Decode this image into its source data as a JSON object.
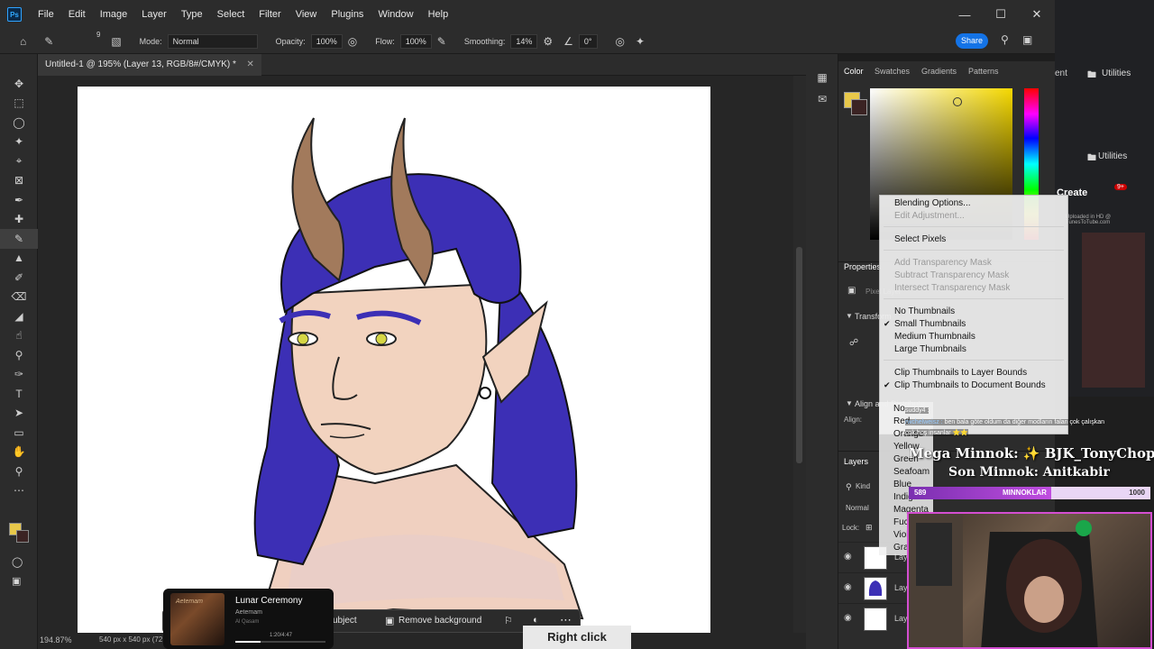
{
  "menubar": {
    "items": [
      "File",
      "Edit",
      "Image",
      "Layer",
      "Type",
      "Select",
      "Filter",
      "View",
      "Plugins",
      "Window",
      "Help"
    ]
  },
  "options": {
    "mode_label": "Mode:",
    "mode_value": "Normal",
    "opacity_label": "Opacity:",
    "opacity_value": "100%",
    "flow_label": "Flow:",
    "flow_value": "100%",
    "smoothing_label": "Smoothing:",
    "smoothing_value": "14%",
    "angle_value": "0°",
    "brush_size": "9",
    "share_label": "Share"
  },
  "document": {
    "tab_title": "Untitled-1 @ 195% (Layer 13, RGB/8#/CMYK) *",
    "zoom": "194.87%",
    "size_info": "540 px x 540 px (72"
  },
  "contextual_bar": {
    "select_subject": "ubject",
    "remove_background": "Remove background"
  },
  "media": {
    "title": "Lunar Ceremony",
    "artist": "Aetemam",
    "album": "Al Qasam",
    "time": "1:20/4:47",
    "art_text": "Aetemam"
  },
  "overlay": {
    "right_click": "Right click"
  },
  "color_panel": {
    "tabs": [
      "Color",
      "Swatches",
      "Gradients",
      "Patterns"
    ],
    "foreground": "#e8c84a",
    "background": "#3b2323"
  },
  "properties": {
    "title": "Properties",
    "pixel_layer": "Pixel Layer",
    "transform": "Transform",
    "align": "Align and Distribute",
    "align_label": "Align:"
  },
  "layers_panel": {
    "title": "Layers",
    "kind": "Kind",
    "blend": "Normal",
    "lock": "Lock:",
    "layer_name": "Lay"
  },
  "context_menu": {
    "blending_options": "Blending Options...",
    "edit_adjustment": "Edit Adjustment...",
    "select_pixels": "Select Pixels",
    "add_mask": "Add Transparency Mask",
    "subtract_mask": "Subtract Transparency Mask",
    "intersect_mask": "Intersect Transparency Mask",
    "no_thumbnails": "No Thumbnails",
    "small_thumbnails": "Small Thumbnails",
    "medium_thumbnails": "Medium Thumbnails",
    "large_thumbnails": "Large Thumbnails",
    "clip_layer": "Clip Thumbnails to Layer Bounds",
    "clip_document": "Clip Thumbnails to Document Bounds",
    "checkmark": "✔"
  },
  "color_labels": [
    "No",
    "Red",
    "Orange",
    "Yellow",
    "Green",
    "Seafoam",
    "Blue",
    "Indigo",
    "Magenta",
    "Fuchsia",
    "Violet",
    "Gray"
  ],
  "browser": {
    "utilities": "Utilities",
    "create": "Create",
    "badge": "9+",
    "event": "ent",
    "uploaded": "Uploaded in HD @ TunesToTube.com"
  },
  "stream": {
    "chat_user1": "suddy4 :",
    "chat_user2": "rwchelweisz :",
    "chat_msg": "ben bala göte oldum da diğer modların falan çok çalışkan",
    "chat_msg2": "çok hoş insanlar ⭐⭐",
    "mega_minnok": "Mega Minnok: ✨ BJK_TonyChopper ✨",
    "son_minnok": "Son Minnok: Anitkabir",
    "bar_left": "589",
    "bar_center": "MINNOKLAR",
    "bar_right": "1000",
    "bar_progress": 0.589
  }
}
